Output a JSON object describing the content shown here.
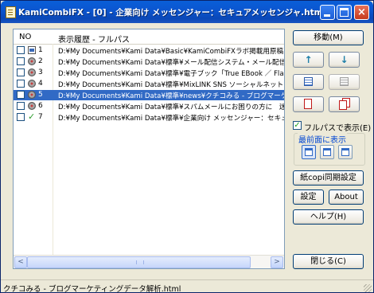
{
  "window": {
    "title": "KamiCombiFX - [0] - 企業向け メッセンジャー：セキュアメッセンジャ.html",
    "minimize_label": "_",
    "maximize_label": "□",
    "close_label": "×"
  },
  "list": {
    "columns": {
      "no": "NO",
      "history": "表示履歴 - フルパス"
    },
    "rows": [
      {
        "no": "1",
        "path": "D:¥My Documents¥Kami Data¥Basic¥KamiCombiFXラボ掲載用原稿.txt",
        "icon": "document-icon",
        "selected": false
      },
      {
        "no": "2",
        "path": "D:¥My Documents¥Kami Data¥標準¥メール配信システム・メール配信ASP",
        "icon": "disc-icon",
        "selected": false
      },
      {
        "no": "3",
        "path": "D:¥My Documents¥Kami Data¥標準¥電子ブック「True EBook ／ Flash E",
        "icon": "disc-icon",
        "selected": false
      },
      {
        "no": "4",
        "path": "D:¥My Documents¥Kami Data¥標準¥MixLINK SNS ソーシャルネットワーク",
        "icon": "disc-icon",
        "selected": false
      },
      {
        "no": "5",
        "path": "D:¥My Documents¥Kami Data¥標準¥news¥クチコみる - ブログマーケティ",
        "icon": "disc-icon",
        "selected": true
      },
      {
        "no": "6",
        "path": "D:¥My Documents¥Kami Data¥標準¥スパムメールにお困りの方に　迷惑",
        "icon": "disc-icon",
        "selected": false
      },
      {
        "no": "7",
        "path": "D:¥My Documents¥Kami Data¥標準¥企業向け メッセンジャー：セキュア",
        "icon": "check-icon",
        "selected": false
      }
    ],
    "scroll_left": "<",
    "scroll_right": ">"
  },
  "side": {
    "move_label": "移動(M)",
    "fullpath_label": "フルパスで表示(E)",
    "front_group_label": "最前面に表示",
    "sync_label": "紙copi同期設定",
    "settings_label": "設定",
    "about_label": "About",
    "help_label": "ヘルプ(H)",
    "close_label": "閉じる(C)",
    "up_arrow": "↑",
    "down_arrow": "↓",
    "check_mark": "✓"
  },
  "status": {
    "text": "クチコみる - ブログマーケティングデータ解析.html"
  }
}
